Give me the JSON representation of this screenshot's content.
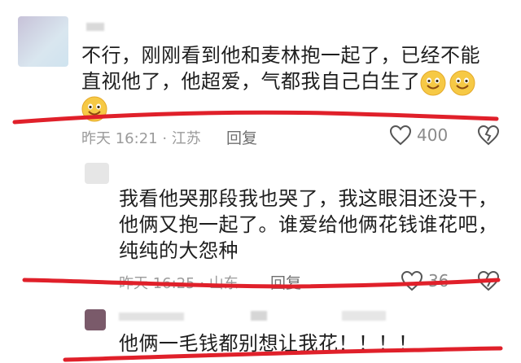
{
  "comments": [
    {
      "lines": [
        "不行，刚刚看到他和麦林抱一起了，已经不能",
        "直视他了，他超爱，气都我自己白生了"
      ],
      "time": "昨天 16:21 · 江苏",
      "reply": "回复",
      "likes": "400"
    },
    {
      "lines": [
        "我看他哭那段我也哭了，我这眼泪还没干，",
        "他俩又抱一起了。谁爱给他俩花钱谁花吧，",
        "纯纯的大怨种"
      ],
      "time": "昨天 16:25 · 山东",
      "reply": "回复",
      "likes": "36"
    },
    {
      "lines": [
        "他俩一毛钱都别想让我花！！！！"
      ]
    }
  ],
  "colors": {
    "annotation": "#e0202a",
    "emoji": "#f6c945"
  },
  "icons": [
    "emoji-smile-icon",
    "heart-icon",
    "broken-heart-icon"
  ]
}
